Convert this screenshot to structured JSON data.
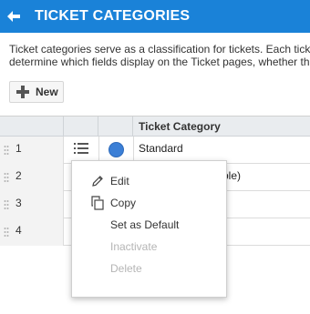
{
  "header": {
    "title": "TICKET CATEGORIES"
  },
  "description": {
    "line1": "Ticket categories serve as a classification for tickets. Each tick",
    "line2": "determine which fields display on the Ticket pages, whether th"
  },
  "toolbar": {
    "new_label": "New"
  },
  "table": {
    "column_header": "Ticket Category",
    "rows": [
      {
        "num": "1",
        "category": "Standard"
      },
      {
        "num": "2",
        "category": "table)"
      },
      {
        "num": "3",
        "category": ""
      },
      {
        "num": "4",
        "category": ""
      }
    ]
  },
  "context_menu": {
    "items": [
      {
        "label": "Edit",
        "icon": "pencil-icon",
        "enabled": true
      },
      {
        "label": "Copy",
        "icon": "copy-icon",
        "enabled": true
      },
      {
        "label": "Set as Default",
        "icon": "",
        "enabled": true
      },
      {
        "label": "Inactivate",
        "icon": "",
        "enabled": false
      },
      {
        "label": "Delete",
        "icon": "",
        "enabled": false
      }
    ]
  },
  "colors": {
    "header": "#1a82d8",
    "category_dot": "#3b7fd6"
  }
}
